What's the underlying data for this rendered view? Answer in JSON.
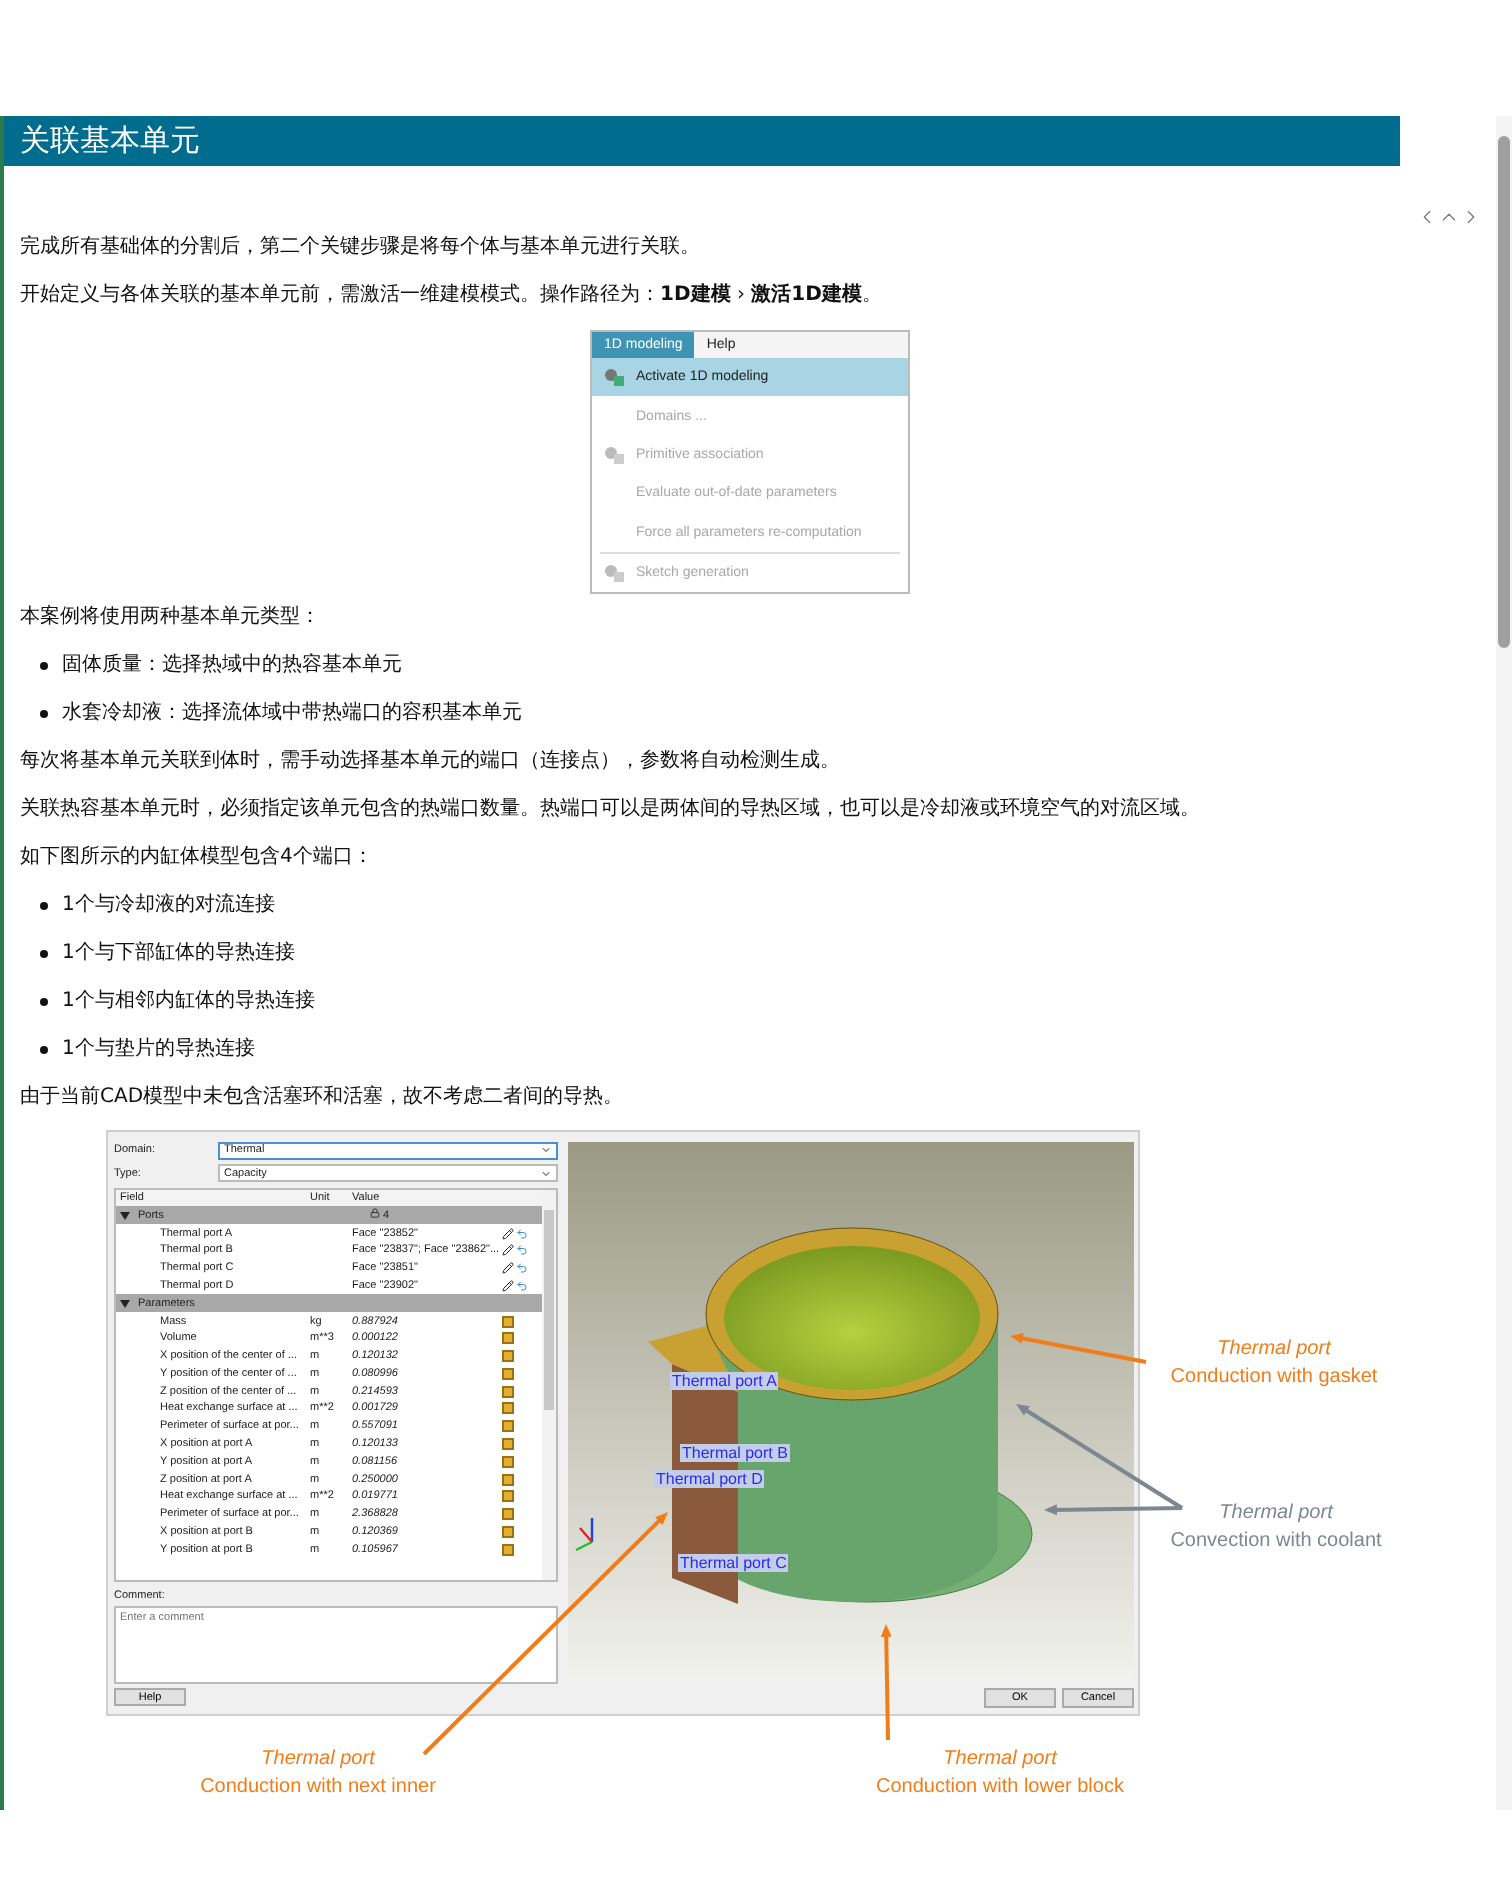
{
  "section_title": "关联基本单元",
  "intro": [
    "完成所有基础体的分割后，第二个关键步骤是将每个体与基本单元进行关联。",
    "开始定义与各体关联的基本单元前，需激活一维建模模式。操作路径为：**1D建模** › **激活1D建模**。"
  ],
  "menu_screenshot": {
    "menus": [
      {
        "label": "1D modeling",
        "selected": true
      },
      {
        "label": "Help",
        "selected": false
      }
    ],
    "groups": [
      {
        "items": [
          {
            "label": "Activate 1D modeling",
            "kind": "icon",
            "selected": true,
            "disabled": false
          },
          {
            "label": "Domains ...",
            "kind": "plain",
            "selected": false,
            "disabled": true
          },
          {
            "label": "Primitive association",
            "kind": "icon",
            "selected": false,
            "disabled": true
          },
          {
            "label": "Evaluate out-of-date parameters",
            "kind": "plain",
            "selected": false,
            "disabled": true
          },
          {
            "label": "Force all parameters re-computation",
            "kind": "plain",
            "selected": false,
            "disabled": true
          }
        ]
      },
      {
        "items": [
          {
            "label": "Sketch generation",
            "kind": "icon",
            "selected": false,
            "disabled": true
          }
        ]
      }
    ]
  },
  "body": [
    {
      "kind": "paragraph",
      "text": "本案例将使用两种基本单元类型："
    },
    {
      "kind": "bullet",
      "text": "固体质量：选择热域中的热容基本单元"
    },
    {
      "kind": "bullet",
      "text": "水套冷却液：选择流体域中带热端口的容积基本单元"
    },
    {
      "kind": "paragraph",
      "text": "每次将基本单元关联到体时，需手动选择基本单元的端口（连接点），参数将自动检测生成。"
    },
    {
      "kind": "paragraph",
      "text": "关联热容基本单元时，必须指定该单元包含的热端口数量。热端口可以是两体间的导热区域，也可以是冷却液或环境空气的对流区域。"
    },
    {
      "kind": "paragraph",
      "text": "如下图所示的内缸体模型包含4个端口："
    },
    {
      "kind": "bullet",
      "text": "1个与冷却液的对流连接"
    },
    {
      "kind": "bullet",
      "text": "1个与下部缸体的导热连接"
    },
    {
      "kind": "bullet",
      "text": "1个与相邻内缸体的导热连接"
    },
    {
      "kind": "bullet",
      "text": "1个与垫片的导热连接"
    },
    {
      "kind": "paragraph",
      "text": "由于当前CAD模型中未包含活塞环和活塞，故不考虑二者间的导热。"
    }
  ],
  "figure": {
    "dialog": {
      "domain": {
        "label": "Domain:",
        "value": "Thermal"
      },
      "type": {
        "label": "Type:",
        "value": "Capacity"
      },
      "table": {
        "columns": [
          "Field",
          "Unit",
          "Value"
        ],
        "groups": [
          {
            "label": "Ports",
            "expanded": true,
            "value": "4",
            "rows": [
              {
                "kind": "port",
                "field": "Thermal port A",
                "unit": "",
                "value": "Face \"23852\""
              },
              {
                "kind": "port",
                "field": "Thermal port B",
                "unit": "",
                "value": "Face \"23837\"; Face \"23862\"..."
              },
              {
                "kind": "port",
                "field": "Thermal port C",
                "unit": "",
                "value": "Face \"23851\""
              },
              {
                "kind": "port",
                "field": "Thermal port D",
                "unit": "",
                "value": "Face \"23902\""
              }
            ]
          },
          {
            "label": "Parameters",
            "expanded": true,
            "rows": [
              {
                "kind": "param",
                "field": "Mass",
                "unit": "kg",
                "value": "0.887924"
              },
              {
                "kind": "param",
                "field": "Volume",
                "unit": "m**3",
                "value": "0.000122"
              },
              {
                "kind": "param",
                "field": "X position of the center of ...",
                "unit": "m",
                "value": "0.120132"
              },
              {
                "kind": "param",
                "field": "Y position of the center of ...",
                "unit": "m",
                "value": "0.080996"
              },
              {
                "kind": "param",
                "field": "Z position of the center of ...",
                "unit": "m",
                "value": "0.214593"
              },
              {
                "kind": "param",
                "field": "Heat exchange surface at ...",
                "unit": "m**2",
                "value": "0.001729"
              },
              {
                "kind": "param",
                "field": "Perimeter of surface at por...",
                "unit": "m",
                "value": "0.557091"
              },
              {
                "kind": "param",
                "field": "X position at port A",
                "unit": "m",
                "value": "0.120133"
              },
              {
                "kind": "param",
                "field": "Y position at port A",
                "unit": "m",
                "value": "0.081156"
              },
              {
                "kind": "param",
                "field": "Z position at port A",
                "unit": "m",
                "value": "0.250000"
              },
              {
                "kind": "param",
                "field": "Heat exchange surface at ...",
                "unit": "m**2",
                "value": "0.019771"
              },
              {
                "kind": "param",
                "field": "Perimeter of surface at por...",
                "unit": "m",
                "value": "2.368828"
              },
              {
                "kind": "param",
                "field": "X position at port B",
                "unit": "m",
                "value": "0.120369"
              },
              {
                "kind": "param",
                "field": "Y position at port B",
                "unit": "m",
                "value": "0.105967"
              }
            ]
          }
        ]
      },
      "comment": {
        "label": "Comment:",
        "placeholder": "Enter a comment"
      },
      "buttons": {
        "help": "Help",
        "ok": "OK",
        "cancel": "Cancel"
      }
    },
    "port_labels": [
      "Thermal port A",
      "Thermal port B",
      "Thermal port D",
      "Thermal port C"
    ],
    "callouts": [
      {
        "title": "Thermal port",
        "text": "Conduction with gasket",
        "color": "#f07d1a"
      },
      {
        "title": "Thermal port",
        "text": "Convection with coolant",
        "color": "#7d8791"
      },
      {
        "title": "Thermal port",
        "text": "Conduction with next inner",
        "color": "#f07d1a"
      },
      {
        "title": "Thermal port",
        "text": "Conduction with lower block",
        "color": "#f07d1a"
      }
    ]
  }
}
